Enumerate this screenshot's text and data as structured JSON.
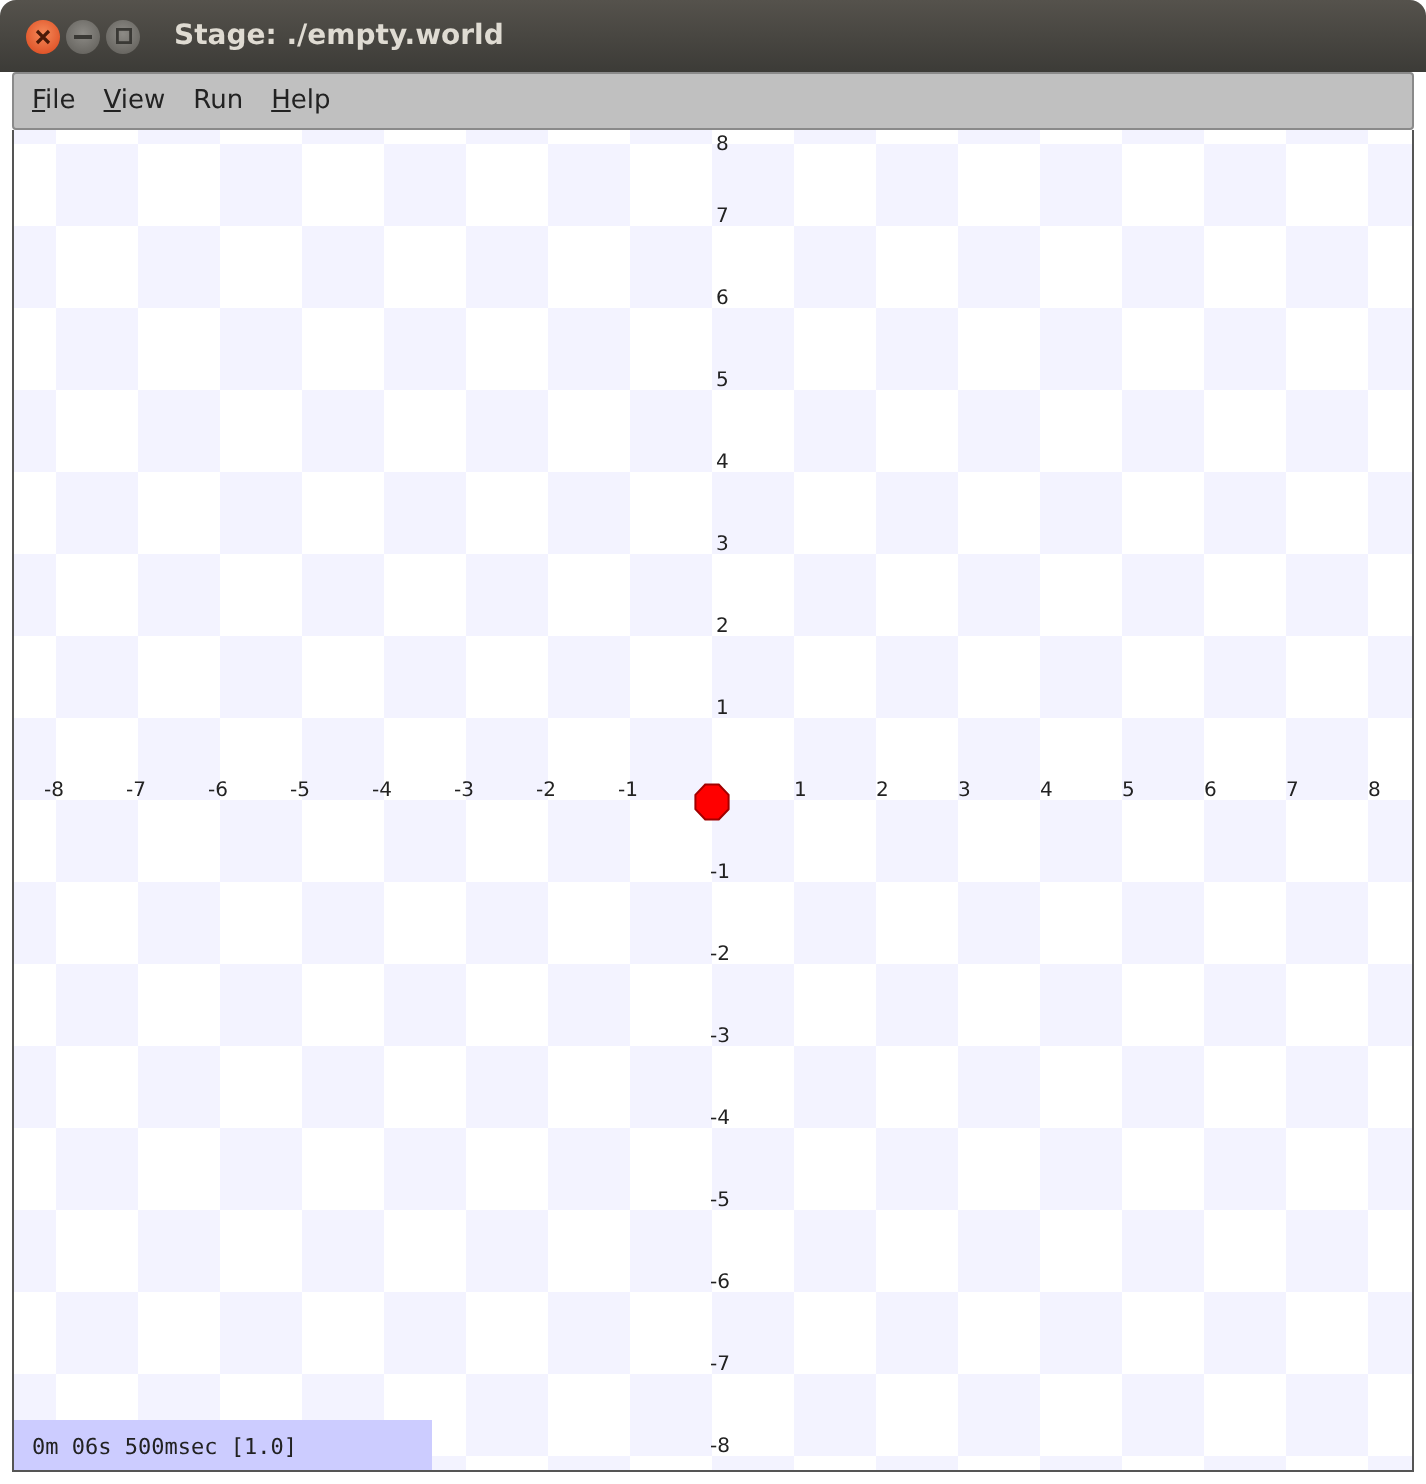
{
  "window": {
    "title": "Stage: ./empty.world"
  },
  "menu": [
    {
      "label": "File",
      "mnemonic": true
    },
    {
      "label": "View",
      "mnemonic": true
    },
    {
      "label": "Run",
      "mnemonic": false
    },
    {
      "label": "Help",
      "mnemonic": true
    }
  ],
  "stage": {
    "x_labels": [
      "-8",
      "-7",
      "-6",
      "-5",
      "-4",
      "-3",
      "-2",
      "-1",
      "1",
      "2",
      "3",
      "4",
      "5",
      "6",
      "7",
      "8"
    ],
    "y_labels": [
      "8",
      "7",
      "6",
      "5",
      "4",
      "3",
      "2",
      "1",
      "-1",
      "-2",
      "-3",
      "-4",
      "-5",
      "-6",
      "-7",
      "-8"
    ]
  },
  "status_bar": "0m 06s 500msec [1.0]"
}
